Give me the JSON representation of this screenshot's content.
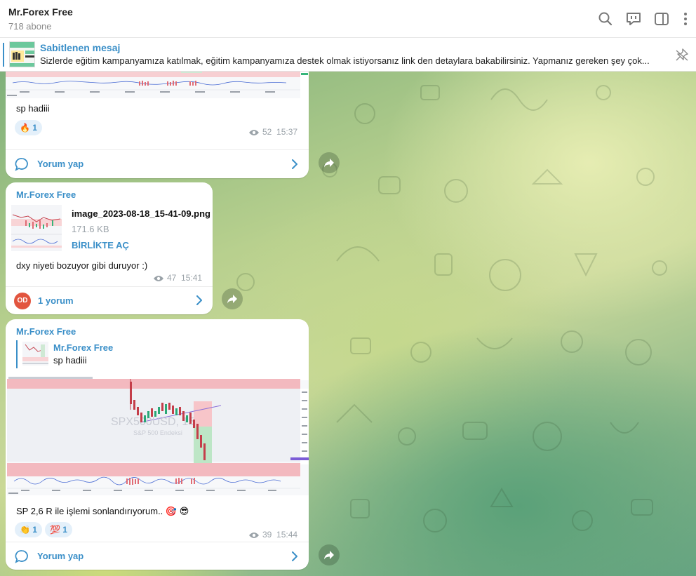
{
  "channel": {
    "name": "Mr.Forex Free",
    "subscribers": "718 abone"
  },
  "header_icons": [
    "search-icon",
    "discussion-icon",
    "sidebar-toggle-icon",
    "more-vertical-icon"
  ],
  "pinned": {
    "title": "Sabitlenen mesaj",
    "text": "Sizlerde eğitim kampanyamıza katılmak, eğitim kampanyamıza destek olmak istiyorsanız link den detaylara bakabilirsiniz. Yapmanız gereken şey çok..."
  },
  "messages": [
    {
      "text": "sp hadiii",
      "reaction": {
        "emoji": "🔥",
        "count": "1"
      },
      "views": "52",
      "time": "15:37",
      "comment_label": "Yorum yap"
    },
    {
      "sender": "Mr.Forex Free",
      "file": {
        "name": "image_2023-08-18_15-41-09.png",
        "size": "171.6 KB",
        "open_label": "BİRLİKTE AÇ"
      },
      "text": "dxy niyeti bozuyor gibi duruyor :)",
      "views": "47",
      "time": "15:41",
      "comment_avatar": "OD",
      "comment_label": "1 yorum"
    },
    {
      "sender": "Mr.Forex Free",
      "reply": {
        "sender": "Mr.Forex Free",
        "text": "sp hadiii"
      },
      "chart_watermark": {
        "symbol": "SPX500USD, 15",
        "name": "S&P 500 Endeksi"
      },
      "text": "SP  2,6 R  ile işlemi sonlandırıyorum.. 🎯 😎",
      "reactions": [
        {
          "emoji": "👏",
          "count": "1"
        },
        {
          "emoji": "💯",
          "count": "1"
        }
      ],
      "views": "39",
      "time": "15:44",
      "comment_label": "Yorum yap"
    }
  ],
  "colors": {
    "accent": "#3a8fc8",
    "bubble": "#ffffff",
    "meta": "#9aa2a8"
  }
}
